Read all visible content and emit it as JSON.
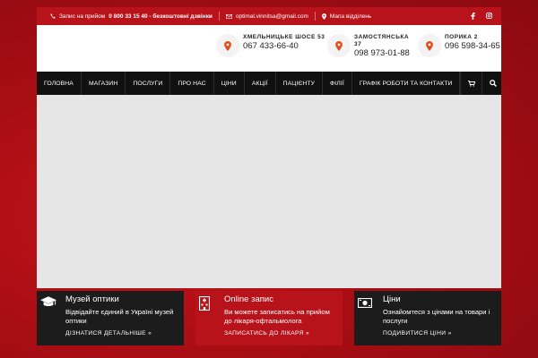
{
  "topbar": {
    "appointment_label": "Запис на прийом",
    "phone": "0 800 33 15 40 - безкоштовні дзвінки",
    "email": "optimal.vinnitsa@gmail.com",
    "map_label": "Мапа відділень",
    "social": [
      "facebook-icon",
      "instagram-icon"
    ]
  },
  "contacts": [
    {
      "address": "ХМЕЛЬНИЦЬКЕ ШОСЕ 53",
      "phone": "067 433-66-40"
    },
    {
      "address": "ЗАМОСТЯНСЬКА 37",
      "phone": "098 973-01-88"
    },
    {
      "address": "ПОРИКА 2",
      "phone": "096 598-34-65"
    }
  ],
  "nav": {
    "items": [
      "ГОЛОВНА",
      "МАГАЗИН",
      "ПОСЛУГИ",
      "ПРО НАС",
      "ЦІНИ",
      "АКЦІЇ",
      "ПАЦІЄНТУ",
      "ФІЛІЇ",
      "ГРАФІК РОБОТИ ТА КОНТАКТИ"
    ]
  },
  "boxes": [
    {
      "title": "Музей оптики",
      "text": "Відвідайте єдиний в Україні музей оптики",
      "link": "ДІЗНАТИСЯ ДЕТАЛЬНІШЕ »",
      "icon": "graduation-cap-icon"
    },
    {
      "title": "Online запис",
      "text": "Ви можете записатись на прийом до лікаря-офтальмолога",
      "link": "ЗАПИСАТИСЬ ДО ЛІКАРЯ »",
      "icon": "hospital-icon"
    },
    {
      "title": "Ціни",
      "text": "Ознайомтеся з цінами на товари і послуги",
      "link": "ПОДИВИТИСЯ ЦІНИ »",
      "icon": "money-icon"
    }
  ],
  "colors": {
    "brand_red": "#b8121a",
    "nav_bg": "#111111",
    "pin": "#e64a19"
  }
}
